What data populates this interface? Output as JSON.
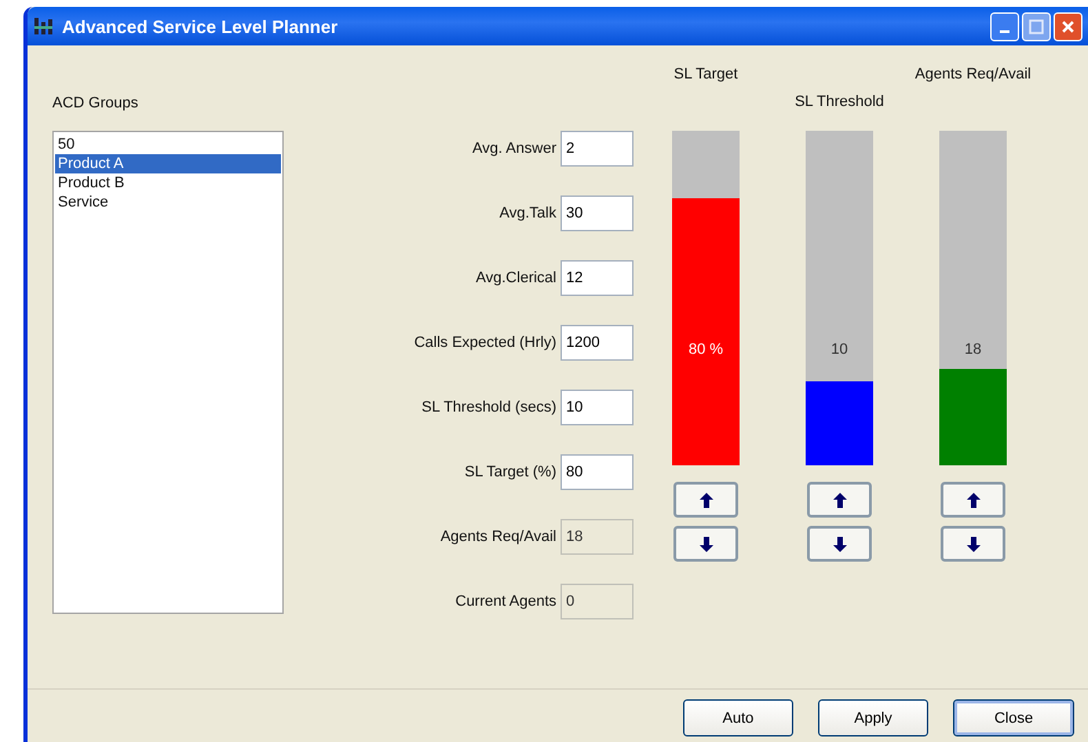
{
  "window": {
    "title": "Advanced Service Level Planner"
  },
  "acd_groups": {
    "label": "ACD Groups",
    "items": [
      {
        "label": "50",
        "selected": false
      },
      {
        "label": "Product A",
        "selected": true
      },
      {
        "label": "Product B",
        "selected": false
      },
      {
        "label": "Service",
        "selected": false
      }
    ]
  },
  "fields": [
    {
      "label": "Avg. Answer",
      "value": "2",
      "disabled": false
    },
    {
      "label": "Avg.Talk",
      "value": "30",
      "disabled": false
    },
    {
      "label": "Avg.Clerical",
      "value": "12",
      "disabled": false
    },
    {
      "label": "Calls Expected (Hrly)",
      "value": "1200",
      "disabled": false
    },
    {
      "label": "SL Threshold (secs)",
      "value": "10",
      "disabled": false
    },
    {
      "label": "SL Target (%)",
      "value": "80",
      "disabled": false
    },
    {
      "label": "Agents Req/Avail",
      "value": "18",
      "disabled": true
    },
    {
      "label": "Current Agents",
      "value": "0",
      "disabled": true
    }
  ],
  "gauges": [
    {
      "title": "SL Target",
      "level": 0.8,
      "reading": "80 %",
      "color": "#ff0000"
    },
    {
      "title": "SL Threshold",
      "level": 0.25,
      "reading": "10",
      "color": "#0000ff"
    },
    {
      "title": "Agents Req/Avail",
      "level": 0.29,
      "reading": "18",
      "color": "#008000"
    }
  ],
  "buttons": [
    {
      "label": "Auto"
    },
    {
      "label": "Apply"
    },
    {
      "label": "Close"
    }
  ]
}
